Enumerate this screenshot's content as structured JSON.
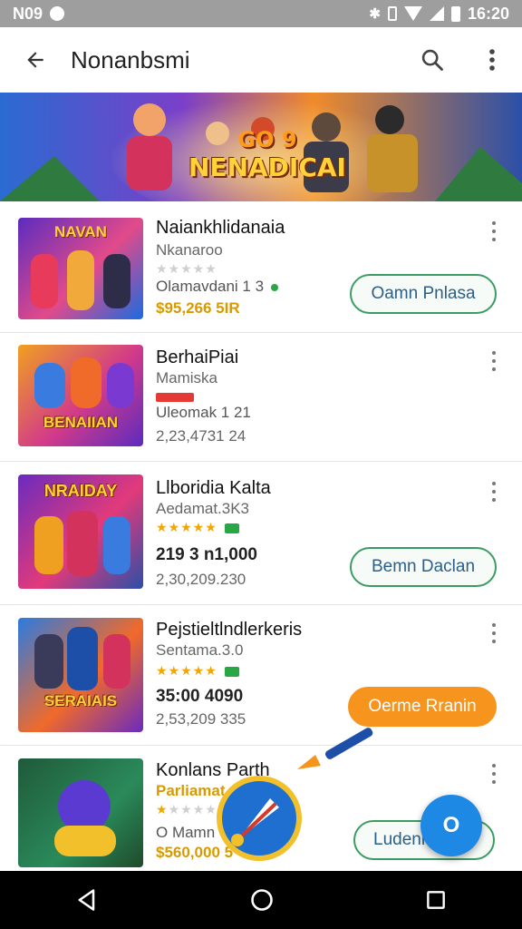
{
  "statusbar": {
    "left_text": "N09",
    "time": "16:20"
  },
  "appbar": {
    "title": "Nonanbsmi"
  },
  "banner": {
    "line1": "GO 9",
    "line2": "NENADICAI"
  },
  "items": [
    {
      "name": "Naiankhlidanaia",
      "sub": "Nkanaroo",
      "line3": "Olamavdani 1 3",
      "line4": "$95,266 5IR",
      "button": "Oamn Pnlasa",
      "thumb_text": "NAVAN"
    },
    {
      "name": "BerhaiPiai",
      "sub": "Mamiska",
      "line3": "Uleomak 1 21",
      "line4": "2,23,4731 24",
      "thumb_text": "BENAIIAN"
    },
    {
      "name": "Llboridia Kalta",
      "sub": "Aedamat.3K3",
      "line3": "219 3 n1,000",
      "line4": "2,30,209.230",
      "button": "Bemn Daclan",
      "thumb_text": "NRAIDAY"
    },
    {
      "name": "Pejstieltlndlerkeris",
      "sub": "Sentama.3.0",
      "line3": "35:00 4090",
      "line4": "2,53,209 335",
      "button": "Oerme Rranin",
      "thumb_text": "SERAIAIS"
    },
    {
      "name": "Konlans Parth",
      "sub": "Parliamat",
      "line3": "O Mamn",
      "line4": "$560,000 5",
      "button": "Ludenn",
      "thumb_text": ""
    }
  ],
  "fab": {
    "label": "O"
  },
  "colors": {
    "accent_green": "#3b9c63",
    "accent_orange": "#f7941d",
    "fab_blue": "#1e88e5",
    "price_gold": "#d89a00"
  }
}
